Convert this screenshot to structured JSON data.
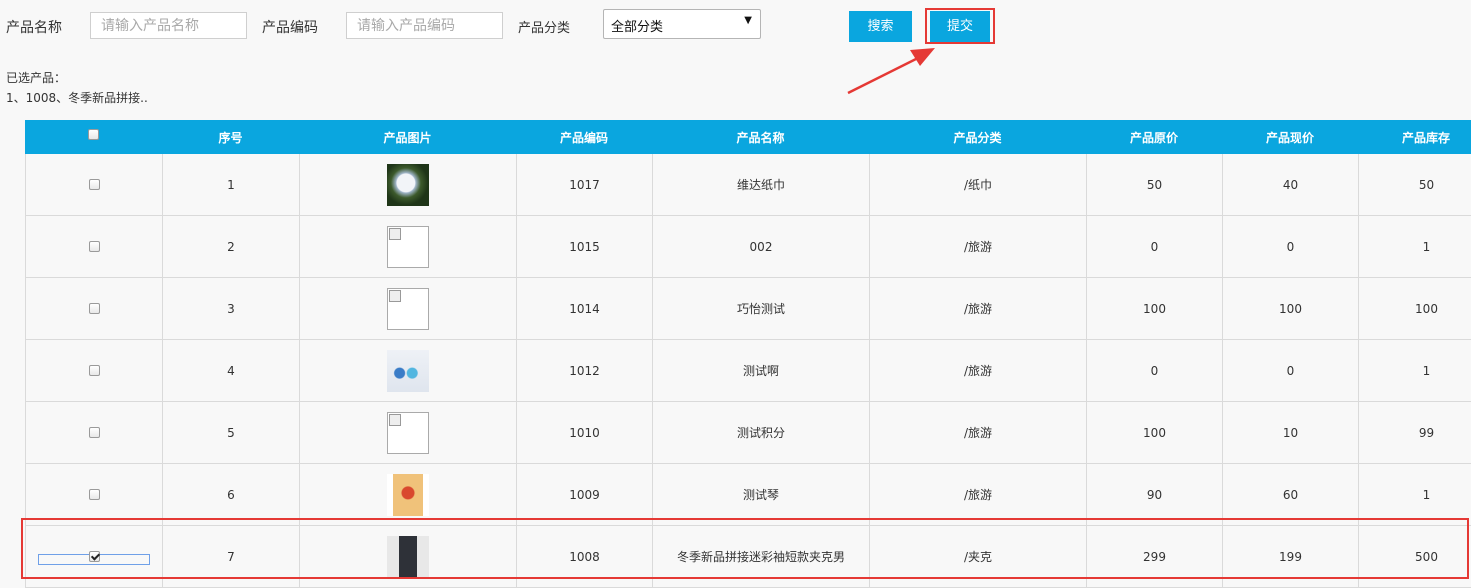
{
  "filters": {
    "name_label": "产品名称",
    "name_placeholder": "请输入产品名称",
    "code_label": "产品编码",
    "code_placeholder": "请输入产品编码",
    "category_label": "产品分类",
    "category_value": "全部分类",
    "search_label": "搜索",
    "submit_label": "提交"
  },
  "selected": {
    "title": "已选产品：",
    "items": "1、1008、冬季新品拼接.."
  },
  "table": {
    "headers": {
      "index": "序号",
      "image": "产品图片",
      "code": "产品编码",
      "name": "产品名称",
      "category": "产品分类",
      "original_price": "产品原价",
      "current_price": "产品现价",
      "stock": "产品库存"
    },
    "rows": [
      {
        "checked": false,
        "index": "1",
        "image": "flower-photo",
        "code": "1017",
        "name": "维达纸巾",
        "category": "/纸巾",
        "original_price": "50",
        "current_price": "40",
        "stock": "50"
      },
      {
        "checked": false,
        "index": "2",
        "image": "broken-image-icon",
        "code": "1015",
        "name": "002",
        "category": "/旅游",
        "original_price": "0",
        "current_price": "0",
        "stock": "1"
      },
      {
        "checked": false,
        "index": "3",
        "image": "broken-image-icon",
        "code": "1014",
        "name": "巧怡测试",
        "category": "/旅游",
        "original_price": "100",
        "current_price": "100",
        "stock": "100"
      },
      {
        "checked": false,
        "index": "4",
        "image": "watch-photo",
        "code": "1012",
        "name": "测试啊",
        "category": "/旅游",
        "original_price": "0",
        "current_price": "0",
        "stock": "1"
      },
      {
        "checked": false,
        "index": "5",
        "image": "broken-image-icon",
        "code": "1010",
        "name": "测试积分",
        "category": "/旅游",
        "original_price": "100",
        "current_price": "10",
        "stock": "99"
      },
      {
        "checked": false,
        "index": "6",
        "image": "package-photo",
        "code": "1009",
        "name": "测试琴",
        "category": "/旅游",
        "original_price": "90",
        "current_price": "60",
        "stock": "1"
      },
      {
        "checked": true,
        "index": "7",
        "image": "jacket-photo",
        "code": "1008",
        "name": "冬季新品拼接迷彩袖短款夹克男",
        "category": "/夹克",
        "original_price": "299",
        "current_price": "199",
        "stock": "500"
      }
    ]
  },
  "colors": {
    "accent": "#0aa6df",
    "highlight": "#e53935"
  }
}
